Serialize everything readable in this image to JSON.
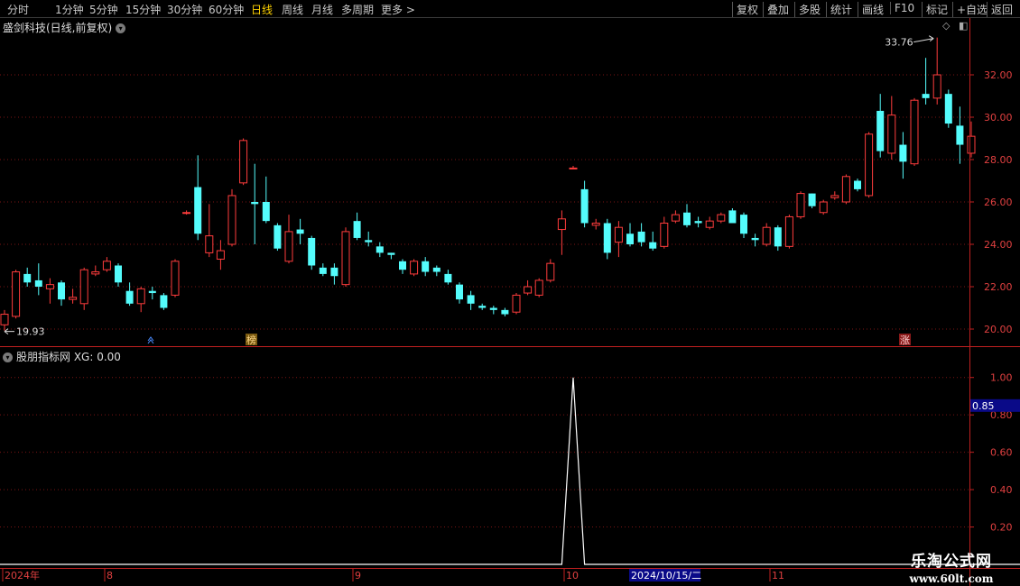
{
  "toolbar": {
    "periods": [
      "分时",
      "1分钟",
      "5分钟",
      "15分钟",
      "30分钟",
      "60分钟",
      "日线",
      "周线",
      "月线",
      "多周期",
      "更多 >"
    ],
    "active_period": "日线",
    "actions": [
      "复权",
      "叠加",
      "多股",
      "统计",
      "画线",
      "F10",
      "标记",
      "+自选",
      "返回"
    ]
  },
  "stock": {
    "title": "盛剑科技(日线,前复权)"
  },
  "price_axis": {
    "ticks": [
      "32.00",
      "30.00",
      "28.00",
      "26.00",
      "24.00",
      "22.00",
      "20.00"
    ]
  },
  "annotations": {
    "high": "33.76",
    "low": "19.93",
    "marker_bang": "榜",
    "marker_zhang": "涨"
  },
  "indicator": {
    "title": "股朋指标网 XG: 0.00",
    "axis_ticks": [
      "1.00",
      "0.80",
      "0.60",
      "0.40",
      "0.20"
    ],
    "cursor_value": "0.85"
  },
  "time_axis": {
    "labels": [
      "2024年",
      "8",
      "9",
      "10",
      "11"
    ],
    "cursor_date": "2024/10/15/二"
  },
  "watermark": {
    "line1": "乐淘公式网",
    "line2": "www.60lt.com"
  },
  "colors": {
    "up": "#ff3c3c",
    "down": "#54fcfc",
    "grid": "#7a1414",
    "axis": "#c02020"
  },
  "chart_data": {
    "type": "candlestick",
    "ylim": [
      19.5,
      34.5
    ],
    "candles": [
      [
        20.2,
        20.7,
        19.93,
        20.9
      ],
      [
        20.6,
        22.7,
        20.5,
        22.8
      ],
      [
        22.6,
        22.2,
        22.0,
        22.9
      ],
      [
        22.3,
        22.0,
        21.6,
        23.1
      ],
      [
        21.9,
        22.1,
        21.2,
        22.4
      ],
      [
        22.2,
        21.4,
        21.1,
        22.3
      ],
      [
        21.4,
        21.5,
        21.2,
        21.9
      ],
      [
        21.2,
        22.8,
        20.9,
        22.9
      ],
      [
        22.6,
        22.7,
        22.5,
        23.0
      ],
      [
        22.8,
        23.2,
        22.7,
        23.4
      ],
      [
        23.0,
        22.2,
        22.0,
        23.1
      ],
      [
        21.8,
        21.2,
        21.1,
        22.2
      ],
      [
        21.2,
        21.9,
        20.8,
        22.0
      ],
      [
        21.8,
        21.7,
        21.4,
        22.0
      ],
      [
        21.6,
        21.0,
        20.9,
        21.7
      ],
      [
        21.6,
        23.2,
        21.5,
        23.3
      ],
      [
        25.5,
        25.5,
        25.4,
        25.6
      ],
      [
        26.7,
        24.5,
        24.2,
        28.2
      ],
      [
        23.6,
        24.4,
        23.4,
        25.9
      ],
      [
        23.3,
        23.7,
        22.8,
        24.2
      ],
      [
        24.0,
        26.3,
        23.9,
        26.6
      ],
      [
        26.9,
        28.9,
        26.8,
        29.0
      ],
      [
        26.0,
        25.9,
        24.0,
        27.8
      ],
      [
        26.0,
        25.1,
        25.0,
        27.2
      ],
      [
        24.9,
        23.8,
        23.7,
        25.0
      ],
      [
        23.2,
        24.6,
        23.1,
        25.4
      ],
      [
        24.7,
        24.5,
        24.0,
        25.2
      ],
      [
        24.3,
        23.0,
        22.8,
        24.4
      ],
      [
        22.9,
        22.6,
        22.5,
        23.1
      ],
      [
        22.9,
        22.5,
        22.1,
        23.1
      ],
      [
        22.1,
        24.6,
        22.0,
        24.8
      ],
      [
        25.1,
        24.3,
        24.2,
        25.5
      ],
      [
        24.2,
        24.1,
        23.9,
        24.6
      ],
      [
        23.9,
        23.6,
        23.4,
        24.1
      ],
      [
        23.6,
        23.5,
        23.3,
        23.6
      ],
      [
        23.2,
        22.8,
        22.6,
        23.3
      ],
      [
        22.6,
        23.2,
        22.5,
        23.3
      ],
      [
        23.2,
        22.7,
        22.5,
        23.4
      ],
      [
        22.9,
        22.7,
        22.5,
        23.0
      ],
      [
        22.6,
        22.2,
        22.1,
        22.8
      ],
      [
        22.1,
        21.4,
        21.2,
        22.2
      ],
      [
        21.6,
        21.2,
        20.9,
        21.8
      ],
      [
        21.1,
        21.0,
        20.9,
        21.2
      ],
      [
        21.0,
        20.9,
        20.7,
        21.1
      ],
      [
        20.9,
        20.7,
        20.6,
        21.0
      ],
      [
        20.8,
        21.6,
        20.7,
        21.7
      ],
      [
        21.7,
        22.0,
        21.6,
        22.3
      ],
      [
        21.6,
        22.3,
        21.5,
        22.4
      ],
      [
        22.3,
        23.1,
        22.2,
        23.3
      ],
      [
        24.7,
        25.2,
        23.5,
        25.6
      ],
      [
        27.6,
        27.6,
        27.6,
        27.7
      ],
      [
        26.6,
        25.0,
        24.8,
        27.0
      ],
      [
        24.9,
        25.0,
        24.7,
        25.2
      ],
      [
        25.0,
        23.6,
        23.3,
        25.2
      ],
      [
        24.1,
        24.8,
        23.4,
        25.1
      ],
      [
        24.5,
        24.0,
        23.9,
        25.0
      ],
      [
        24.6,
        24.1,
        23.9,
        25.0
      ],
      [
        24.1,
        23.8,
        23.7,
        24.6
      ],
      [
        23.9,
        25.0,
        23.8,
        25.3
      ],
      [
        25.1,
        25.4,
        25.0,
        25.6
      ],
      [
        25.5,
        24.9,
        24.8,
        25.9
      ],
      [
        25.1,
        25.0,
        24.8,
        25.3
      ],
      [
        24.8,
        25.1,
        24.7,
        25.3
      ],
      [
        25.1,
        25.4,
        25.0,
        25.5
      ],
      [
        25.6,
        25.0,
        25.0,
        25.7
      ],
      [
        25.4,
        24.5,
        24.3,
        25.5
      ],
      [
        24.3,
        24.2,
        23.9,
        24.5
      ],
      [
        24.0,
        24.8,
        23.9,
        25.0
      ],
      [
        24.8,
        23.9,
        23.7,
        24.9
      ],
      [
        23.9,
        25.3,
        23.8,
        25.4
      ],
      [
        25.3,
        26.4,
        25.2,
        26.5
      ],
      [
        26.4,
        25.8,
        25.7,
        26.4
      ],
      [
        25.5,
        26.0,
        25.4,
        26.1
      ],
      [
        26.2,
        26.3,
        26.1,
        26.5
      ],
      [
        26.0,
        27.2,
        25.9,
        27.3
      ],
      [
        27.0,
        26.6,
        26.5,
        27.1
      ],
      [
        26.3,
        29.2,
        26.2,
        29.3
      ],
      [
        30.3,
        28.4,
        28.1,
        31.1
      ],
      [
        28.3,
        30.1,
        28.0,
        31.0
      ],
      [
        28.7,
        27.9,
        27.1,
        29.3
      ],
      [
        27.8,
        30.8,
        27.7,
        30.9
      ],
      [
        31.1,
        30.9,
        30.6,
        32.8
      ],
      [
        30.9,
        32.0,
        30.6,
        33.76
      ],
      [
        31.1,
        29.7,
        29.5,
        31.3
      ],
      [
        29.6,
        28.7,
        27.8,
        30.5
      ],
      [
        28.3,
        29.1,
        28.1,
        29.8
      ]
    ],
    "indicator_series": {
      "name": "XG",
      "spike_index": 50,
      "spike_value": 1.0,
      "ylim": [
        0,
        1.1
      ]
    }
  }
}
